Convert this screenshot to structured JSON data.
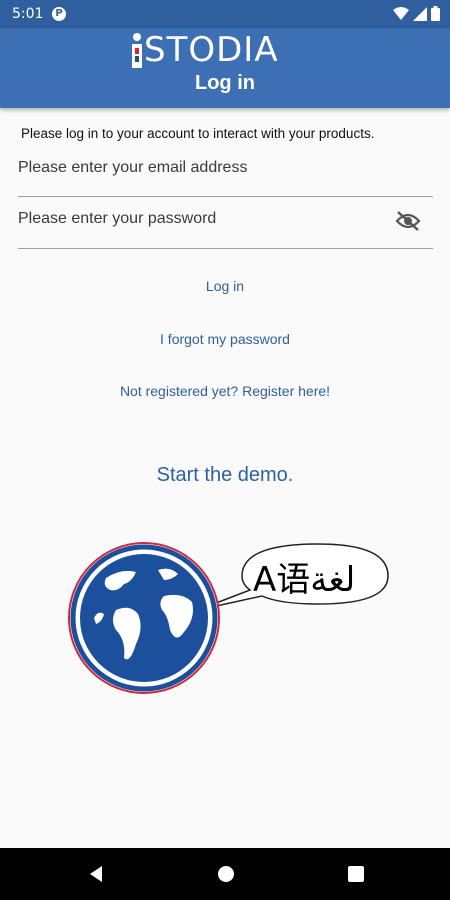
{
  "status_bar": {
    "time": "5:01",
    "badge": "P",
    "icons": [
      "wifi-icon",
      "signal-icon",
      "battery-icon"
    ]
  },
  "app_bar": {
    "logo_text": "STODIA",
    "title": "Log in"
  },
  "intro_text": "Please log in to your account to interact with your products.",
  "form": {
    "email_placeholder": "Please enter your email address",
    "password_placeholder": "Please enter your password",
    "password_icon": "visibility-off-icon"
  },
  "links": {
    "login": "Log in",
    "forgot": "I forgot my password",
    "register": "Not registered yet? Register here!",
    "demo": "Start the demo."
  },
  "illustration": {
    "bubble_text": "A语لغة",
    "icon": "globe-icon"
  },
  "nav_bar": {
    "icons": [
      "back-icon",
      "home-icon",
      "recents-icon"
    ]
  },
  "colors": {
    "status_bar": "#2f5f9e",
    "app_bar": "#3d6fb5",
    "link": "#2f5f9e",
    "globe_ring_red": "#d1273a",
    "globe_blue": "#1c4f9c"
  }
}
